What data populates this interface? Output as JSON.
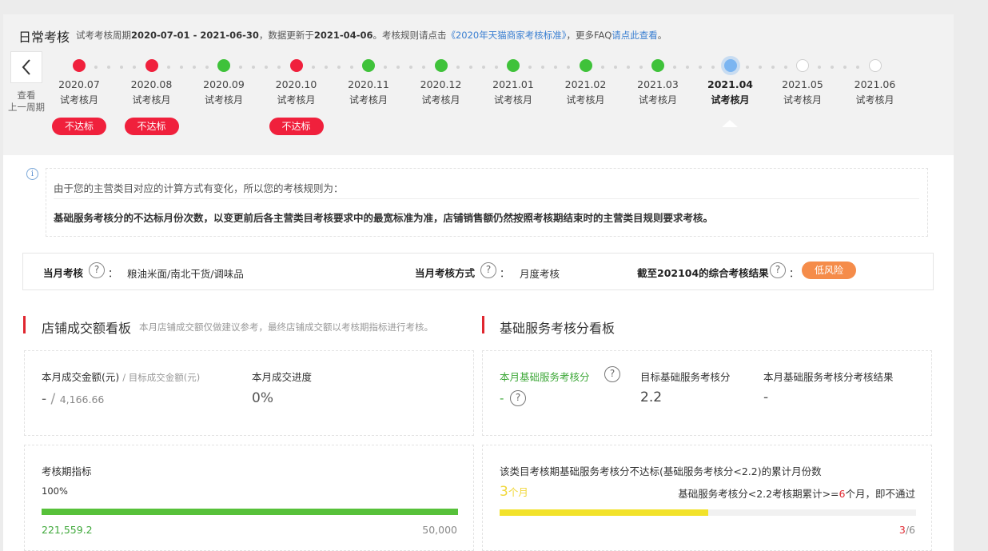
{
  "header": {
    "title": "日常考核",
    "desc_prefix": "试考考核周期",
    "period": "2020-07-01 - 2021-06-30",
    "desc_mid": "，数据更新于",
    "updated": "2021-04-06",
    "desc_mid2": "。考核规则请点击",
    "rule_link": "《2020年天猫商家考核标准》",
    "desc_mid3": "，更多FAQ",
    "faq_link": "请点此查看",
    "desc_end": "。"
  },
  "nav": {
    "back_line1": "查看",
    "back_line2": "上一周期"
  },
  "timeline": [
    {
      "date": "2020.07",
      "type": "试考核月",
      "status": "red",
      "badge": "不达标"
    },
    {
      "date": "2020.08",
      "type": "试考核月",
      "status": "red",
      "badge": "不达标"
    },
    {
      "date": "2020.09",
      "type": "试考核月",
      "status": "green",
      "badge": ""
    },
    {
      "date": "2020.10",
      "type": "试考核月",
      "status": "red",
      "badge": "不达标"
    },
    {
      "date": "2020.11",
      "type": "试考核月",
      "status": "green",
      "badge": ""
    },
    {
      "date": "2020.12",
      "type": "试考核月",
      "status": "green",
      "badge": ""
    },
    {
      "date": "2021.01",
      "type": "试考核月",
      "status": "green",
      "badge": ""
    },
    {
      "date": "2021.02",
      "type": "试考核月",
      "status": "green",
      "badge": ""
    },
    {
      "date": "2021.03",
      "type": "试考核月",
      "status": "green",
      "badge": ""
    },
    {
      "date": "2021.04",
      "type": "试考核月",
      "status": "current",
      "badge": ""
    },
    {
      "date": "2021.05",
      "type": "试考核月",
      "status": "empty",
      "badge": ""
    },
    {
      "date": "2021.06",
      "type": "试考核月",
      "status": "empty",
      "badge": ""
    }
  ],
  "notice": {
    "line1": "由于您的主营类目对应的计算方式有变化，所以您的考核规则为：",
    "line2": "基础服务考核分的不达标月份次数，以变更前后各主营类目考核要求中的最宽标准为准，店铺销售额仍然按照考核期结束时的主营类目规则要求考核。"
  },
  "summary": {
    "month_label": "当月考核",
    "month_value": "粮油米面/南北干货/调味品",
    "method_label": "当月考核方式",
    "method_value": "月度考核",
    "result_label": "截至202104的综合考核结果",
    "result_value": "低风险",
    "colon": "："
  },
  "sales": {
    "title": "店铺成交额看板",
    "note": "本月店铺成交额仅做建议参考，最终店铺成交额以考核期指标进行考核。",
    "amount_label": "本月成交金额(元)",
    "target_label": "/ 目标成交金额(元)",
    "amount_value": "-",
    "slash": "/",
    "target_value": "4,166.66",
    "progress_label": "本月成交进度",
    "progress_value": "0%",
    "period_label": "考核期指标",
    "period_pct": "100%",
    "period_fill": 1.0,
    "period_current": "221,559.2",
    "period_target": "50,000"
  },
  "service": {
    "title": "基础服务考核分看板",
    "score_label": "本月基础服务考核分",
    "score_value": "-",
    "target_label": "目标基础服务考核分",
    "target_value": "2.2",
    "result_label": "本月基础服务考核分考核结果",
    "result_value": "-",
    "cum_label": "该类目考核期基础服务考核分不达标(基础服务考核分<2.2)的累计月份数",
    "cum_value": "3",
    "cum_unit": "个月",
    "rule_prefix": "基础服务考核分<2.2考核期累计>=",
    "rule_num": "6",
    "rule_suffix": "个月，即不通过",
    "cum_fill": 0.5,
    "count_current": "3",
    "count_total": "/6"
  },
  "colors": {
    "red": "#f0203c",
    "green": "#3fc23a",
    "blue": "#7bb5f1",
    "orange": "#f58c4a",
    "yellow": "#f2e22a",
    "link": "#3a7fd1"
  }
}
